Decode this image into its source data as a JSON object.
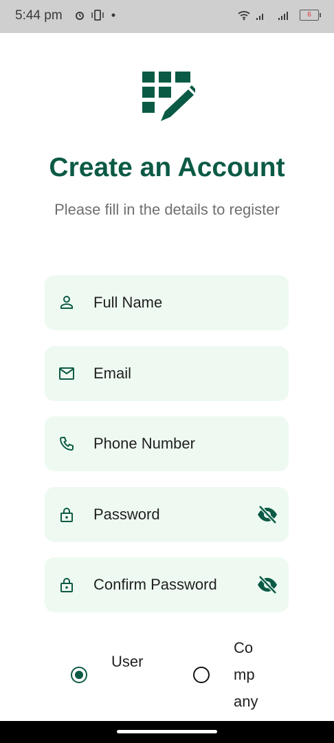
{
  "status_bar": {
    "time": "5:44 pm",
    "battery": "6"
  },
  "header": {
    "title": "Create an Account",
    "subtitle": "Please fill in the details to register"
  },
  "fields": [
    {
      "label": "Full Name",
      "icon": "person-icon"
    },
    {
      "label": "Email",
      "icon": "mail-icon"
    },
    {
      "label": "Phone Number",
      "icon": "phone-icon"
    },
    {
      "label": "Password",
      "icon": "lock-icon",
      "toggle": "eye-off-icon"
    },
    {
      "label": "Confirm Password",
      "icon": "lock-icon",
      "toggle": "eye-off-icon"
    }
  ],
  "account_type": {
    "options": [
      {
        "label": "User",
        "selected": true
      },
      {
        "label": "Company",
        "selected": false
      }
    ]
  },
  "colors": {
    "primary": "#0b5a45",
    "field_background": "#eefaf1",
    "subtitle": "#6f6f6f"
  }
}
